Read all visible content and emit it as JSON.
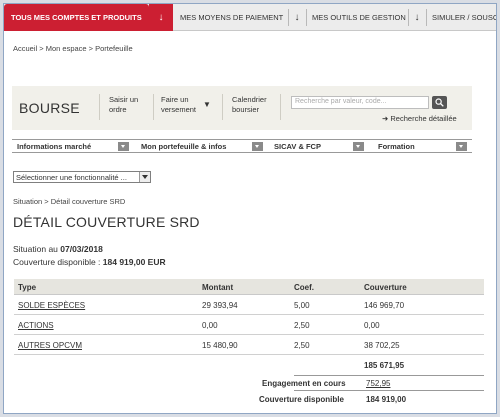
{
  "nav": {
    "tabs": [
      {
        "label": "TOUS MES COMPTES ET PRODUITS"
      },
      {
        "label": "MES MOYENS DE PAIEMENT"
      },
      {
        "label": "MES OUTILS DE GESTION"
      },
      {
        "label": "SIMULER / SOUSCRIRE"
      }
    ]
  },
  "breadcrumb": "Accueil > Mon espace > Portefeuille",
  "bourse": {
    "title": "BOURSE",
    "links": {
      "order_1": "Saisir un",
      "order_2": "ordre",
      "versement_1": "Faire un",
      "versement_2": "versement",
      "calendar_1": "Calendrier",
      "calendar_2": "boursier"
    },
    "search_placeholder": "Recherche par valeur, code...",
    "advanced_search": "Recherche détaillée"
  },
  "categories": [
    "Informations marché",
    "Mon portefeuille & infos",
    "SICAV & FCP",
    "Formation"
  ],
  "select_value": "Sélectionner une fonctionnalité ...",
  "breadcrumb2": "Situation > Détail couverture SRD",
  "page_title": "DÉTAIL COUVERTURE SRD",
  "situation_label": "Situation au ",
  "situation_date": "07/03/2018",
  "coverage_label": "Couverture disponible : ",
  "coverage_value": "184 919,00 EUR",
  "table": {
    "headers": {
      "type": "Type",
      "montant": "Montant",
      "coef": "Coef.",
      "couverture": "Couverture"
    },
    "rows": [
      {
        "type": "SOLDE ESPÈCES",
        "montant": "29 393,94",
        "coef": "5,00",
        "couverture": "146 969,70"
      },
      {
        "type": "ACTIONS",
        "montant": "0,00",
        "coef": "2,50",
        "couverture": "0,00"
      },
      {
        "type": "AUTRES OPCVM",
        "montant": "15 480,90",
        "coef": "2,50",
        "couverture": "38 702,25"
      }
    ],
    "subtotal": "185 671,95",
    "engagement_label": "Engagement en cours",
    "engagement_value": "752,95",
    "available_label": "Couverture disponible",
    "available_value": "184 919,00"
  },
  "colors": {
    "brand_red": "#cc1f32",
    "banner_bg": "#f1f0ea",
    "table_header_bg": "#e6e5df"
  }
}
